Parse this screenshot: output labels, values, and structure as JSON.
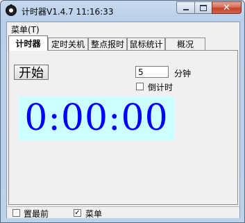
{
  "window": {
    "title": "计时器V1.4.7 11:16:33",
    "close_glyph": "✕"
  },
  "menubar": {
    "menu_label": "菜单(T)"
  },
  "tabs": [
    {
      "label": "计时器",
      "active": true
    },
    {
      "label": "定时关机",
      "active": false
    },
    {
      "label": "整点报时",
      "active": false
    },
    {
      "label": "鼠标统计",
      "active": false
    },
    {
      "label": "概况",
      "active": false
    }
  ],
  "timer": {
    "start_label": "开始",
    "minutes_value": "5",
    "minutes_unit": "分钟",
    "countdown_label": "倒计时",
    "countdown_checked": false,
    "display_time": "0:00:00"
  },
  "statusbar": {
    "always_on_top_label": "置最前",
    "always_on_top_checked": false,
    "menu_label": "菜单",
    "menu_checked": true,
    "check_glyph": "✓"
  },
  "colors": {
    "display_bg": "#ccffff",
    "display_fg": "#0000ff",
    "close_button": "#c2452b"
  }
}
